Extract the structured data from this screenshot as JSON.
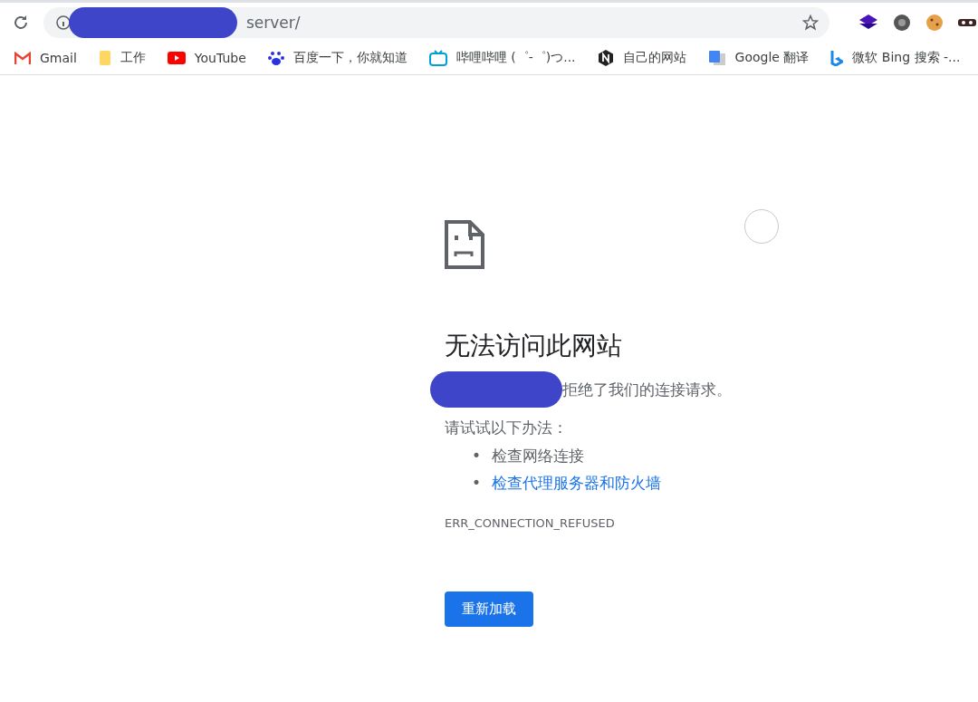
{
  "address_bar": {
    "url": "server/",
    "redacted": true
  },
  "bookmarks": [
    {
      "kind": "gmail",
      "label": "Gmail"
    },
    {
      "kind": "folder",
      "label": "工作"
    },
    {
      "kind": "youtube",
      "label": "YouTube"
    },
    {
      "kind": "baidu",
      "label": "百度一下，你就知道"
    },
    {
      "kind": "bilibili",
      "label": "哔哩哔哩 (゜-゜)つ..."
    },
    {
      "kind": "hexagon",
      "label": "自己的网站"
    },
    {
      "kind": "translate",
      "label": "Google 翻译"
    },
    {
      "kind": "bing",
      "label": "微软 Bing 搜索 -..."
    }
  ],
  "error_page": {
    "title": "无法访问此网站",
    "message": {
      "text": "拒绝了我们的连接请求。",
      "redacted": true
    },
    "suggestion_intro": "请试试以下办法：",
    "suggestions": [
      {
        "kind": "text",
        "bullet": "•",
        "label": "检查网络连接"
      },
      {
        "kind": "link",
        "bullet": "•",
        "label": "检查代理服务器和防火墙"
      }
    ],
    "error_code": "ERR_CONNECTION_REFUSED",
    "reload_button": "重新加载"
  }
}
